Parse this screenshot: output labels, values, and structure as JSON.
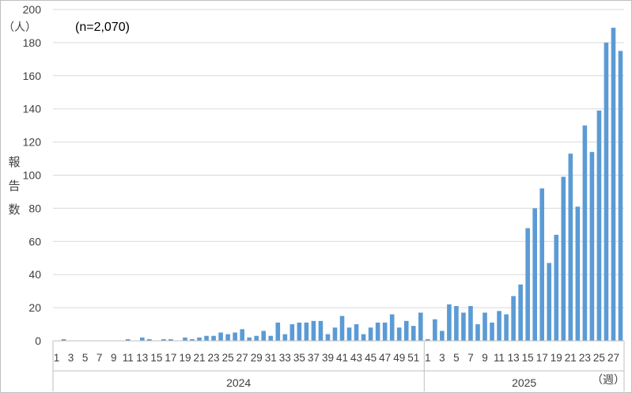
{
  "note": "(n=2,070)",
  "y_unit": "（人）",
  "x_unit": "（週）",
  "ylabel_chars": "報\n告\n数",
  "colors": {
    "bar": "#5B9BD5",
    "grid": "#d9d9d9",
    "axis": "#bfbfbf",
    "text": "#404040"
  },
  "chart_data": {
    "type": "bar",
    "title": "",
    "ylabel": "報告数",
    "xlabel": "週",
    "ylim": [
      0,
      200
    ],
    "yticks": [
      0,
      20,
      40,
      60,
      80,
      100,
      120,
      140,
      160,
      180,
      200
    ],
    "grid": true,
    "groups": [
      {
        "name": "2024",
        "categories": [
          1,
          2,
          3,
          4,
          5,
          6,
          7,
          8,
          9,
          10,
          11,
          12,
          13,
          14,
          15,
          16,
          17,
          18,
          19,
          20,
          21,
          22,
          23,
          24,
          25,
          26,
          27,
          28,
          29,
          30,
          31,
          32,
          33,
          34,
          35,
          36,
          37,
          38,
          39,
          40,
          41,
          42,
          43,
          44,
          45,
          46,
          47,
          48,
          49,
          50,
          51,
          52
        ],
        "tick_labels": [
          "1",
          "3",
          "5",
          "7",
          "9",
          "11",
          "13",
          "15",
          "17",
          "19",
          "21",
          "23",
          "25",
          "27",
          "29",
          "31",
          "33",
          "35",
          "37",
          "39",
          "41",
          "43",
          "45",
          "47",
          "49",
          "51"
        ],
        "values": [
          0,
          1,
          0,
          0,
          0,
          0,
          0,
          0,
          0,
          0,
          1,
          0,
          2,
          1,
          0,
          1,
          1,
          0,
          2,
          1,
          2,
          3,
          3,
          5,
          4,
          5,
          7,
          2,
          3,
          6,
          3,
          11,
          4,
          10,
          11,
          11,
          12,
          12,
          4,
          8,
          15,
          8,
          10,
          4,
          8,
          11,
          11,
          16,
          8,
          12,
          9,
          17
        ]
      },
      {
        "name": "2025",
        "categories": [
          1,
          2,
          3,
          4,
          5,
          6,
          7,
          8,
          9,
          10,
          11,
          12,
          13,
          14,
          15,
          16,
          17,
          18,
          19,
          20,
          21,
          22,
          23,
          24,
          25,
          26,
          27,
          28
        ],
        "tick_labels": [
          "1",
          "3",
          "5",
          "7",
          "9",
          "11",
          "13",
          "15",
          "17",
          "19",
          "21",
          "23",
          "25",
          "27"
        ],
        "values": [
          1,
          13,
          6,
          22,
          21,
          17,
          21,
          10,
          17,
          11,
          18,
          16,
          27,
          34,
          68,
          80,
          92,
          47,
          64,
          99,
          113,
          81,
          130,
          114,
          139,
          180,
          189,
          175
        ]
      }
    ]
  }
}
